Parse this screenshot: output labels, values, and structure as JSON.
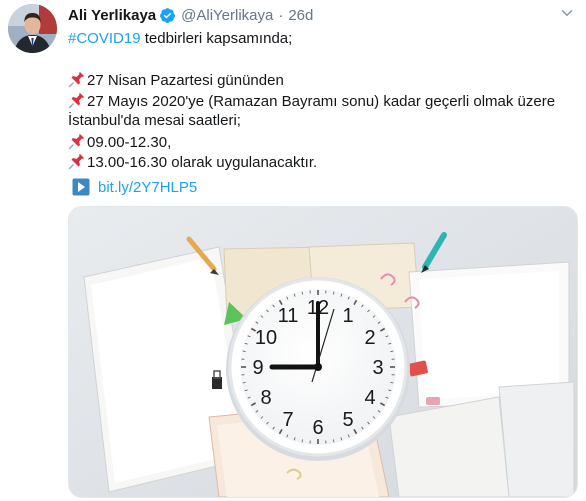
{
  "tweet": {
    "author_name": "Ali Yerlikaya",
    "handle": "@AliYerlikaya",
    "separator": "·",
    "time": "26d",
    "verified": true,
    "hashtag": "#COVID19",
    "line1_rest": " tedbirleri kapsamında;",
    "line2": "27 Nisan Pazartesi gününden",
    "line3": "27 Mayıs 2020'ye (Ramazan Bayramı sonu) kadar geçerli olmak üzere",
    "line4": "İstanbul'da mesai saatleri;",
    "line5": "09.00-12.30,",
    "line6": "13.00-16.30 olarak uygulanacaktır.",
    "link": "bit.ly/2Y7HLP5",
    "clock_numbers": [
      "12",
      "1",
      "2",
      "3",
      "4",
      "5",
      "6",
      "7",
      "8",
      "9",
      "10",
      "11"
    ]
  },
  "icons": {
    "pin": "pushpin-icon",
    "verified": "verified-badge-icon",
    "link": "link-card-icon",
    "more": "chevron-down-icon"
  },
  "colors": {
    "link": "#1da1f2",
    "secondary_text": "#657786",
    "primary_text": "#14171a",
    "pin_red": "#dd2e44"
  }
}
